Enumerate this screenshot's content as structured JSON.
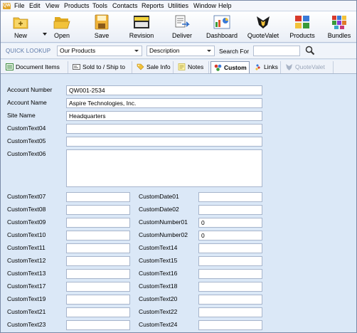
{
  "menu": [
    "File",
    "Edit",
    "View",
    "Products",
    "Tools",
    "Contacts",
    "Reports",
    "Utilities",
    "Window",
    "Help"
  ],
  "app_icon_text": "QW",
  "toolbar": [
    {
      "label": "New",
      "icon": "new-folder-icon"
    },
    {
      "label": "Open",
      "icon": "open-folder-icon"
    },
    {
      "label": "Save",
      "icon": "floppy-disk-icon"
    },
    {
      "label": "Revision",
      "icon": "revision-icon"
    },
    {
      "label": "Deliver",
      "icon": "deliver-icon"
    },
    {
      "label": "Dashboard",
      "icon": "dashboard-icon"
    },
    {
      "label": "QuoteValet",
      "icon": "quotevalet-icon"
    },
    {
      "label": "Products",
      "icon": "products-icon"
    },
    {
      "label": "Bundles",
      "icon": "bundles-icon"
    }
  ],
  "lookup": {
    "title": "QUICK LOOKUP",
    "source": "Our Products",
    "field": "Description",
    "search_label": "Search For",
    "search_value": ""
  },
  "tabs": [
    {
      "label": "Document Items",
      "state": "normal"
    },
    {
      "label": "Sold to / Ship to",
      "state": "normal"
    },
    {
      "label": "Sale Info",
      "state": "normal"
    },
    {
      "label": "Notes",
      "state": "normal"
    },
    {
      "label": "Custom",
      "state": "active"
    },
    {
      "label": "Links",
      "state": "normal"
    },
    {
      "label": "QuoteValet",
      "state": "disabled"
    }
  ],
  "form": {
    "account_number_label": "Account Number",
    "account_number": "QW001-2534",
    "account_name_label": "Account Name",
    "account_name": "Aspire Technologies, Inc.",
    "site_name_label": "Site Name",
    "site_name": "Headquarters",
    "custom_text04_label": "CustomText04",
    "custom_text05_label": "CustomText05",
    "custom_text06_label": "CustomText06",
    "left_column": [
      "CustomText07",
      "CustomText08",
      "CustomText09",
      "CustomText10",
      "CustomText11",
      "CustomText12",
      "CustomText13",
      "CustomText17",
      "CustomText19",
      "CustomText21",
      "CustomText23"
    ],
    "right_column": [
      {
        "label": "CustomDate01",
        "value": ""
      },
      {
        "label": "CustomDate02",
        "value": ""
      },
      {
        "label": "CustomNumber01",
        "value": "0"
      },
      {
        "label": "CustomNumber02",
        "value": "0"
      },
      {
        "label": "CustomText14",
        "value": ""
      },
      {
        "label": "CustomText15",
        "value": ""
      },
      {
        "label": "CustomText16",
        "value": ""
      },
      {
        "label": "CustomText18",
        "value": ""
      },
      {
        "label": "CustomText20",
        "value": ""
      },
      {
        "label": "CustomText22",
        "value": ""
      },
      {
        "label": "CustomText24",
        "value": ""
      }
    ]
  },
  "colors": {
    "form_background": "#dbe8f7",
    "lookup_title": "#5b78a8",
    "folder_yellow": "#f2c23a"
  }
}
